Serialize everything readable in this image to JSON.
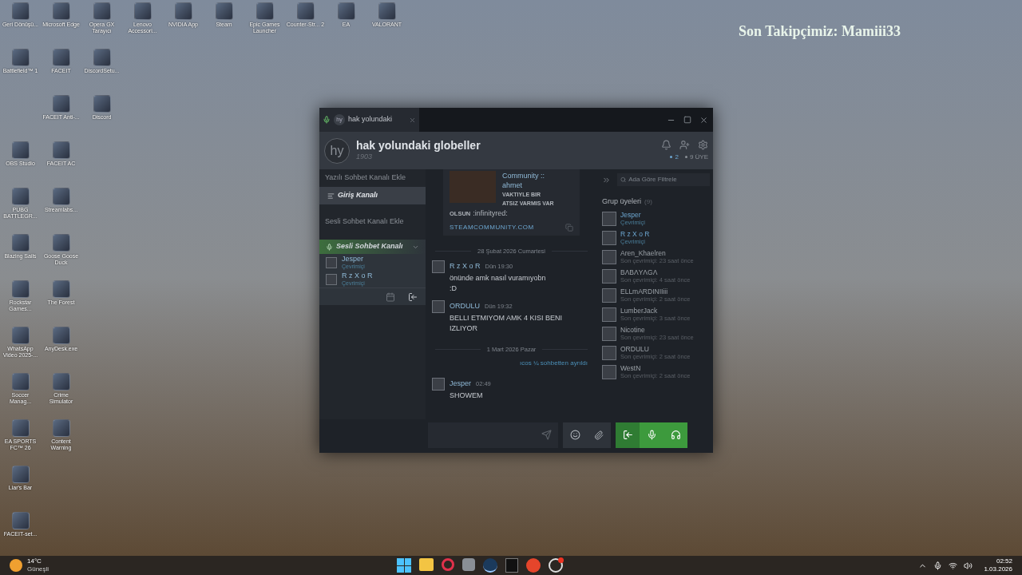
{
  "overlay": {
    "text": "Son Takipçimiz: Mamiii33"
  },
  "desktop_rows": [
    [
      {
        "label": "Geri Dönüşü..."
      },
      {
        "label": "Microsoft Edge"
      },
      {
        "label": "Opera GX Tarayıcı"
      },
      {
        "label": "Lenovo Accessori..."
      },
      {
        "label": "NVIDIA App"
      },
      {
        "label": "Steam"
      },
      {
        "label": "Epic Games Launcher"
      },
      {
        "label": "Counter-Str... 2"
      },
      {
        "label": "EA"
      },
      {
        "label": "VALORANT"
      }
    ],
    [
      {
        "label": "Battlefield™ 1"
      },
      {
        "label": "FACEIT"
      },
      {
        "label": "DiscordSetu..."
      }
    ],
    [
      null,
      {
        "label": "FACEIT Anti-..."
      },
      {
        "label": "Discord"
      }
    ],
    [
      {
        "label": "OBS Studio"
      },
      {
        "label": "FACEIT AC"
      }
    ],
    [
      {
        "label": "PUBG BATTLEGR..."
      },
      {
        "label": "Streamlabs..."
      }
    ],
    [
      {
        "label": "Blazing Sails"
      },
      {
        "label": "Goose Goose Duck"
      }
    ],
    [
      {
        "label": "Rockstar Games..."
      },
      {
        "label": "The Forest"
      }
    ],
    [
      {
        "label": "WhatsApp Video 2025-..."
      },
      {
        "label": "AnyDesk.exe"
      }
    ],
    [
      {
        "label": "Soccer Manag..."
      },
      {
        "label": "Crime Simulator"
      }
    ],
    [
      {
        "label": "EA SPORTS FC™ 26"
      },
      {
        "label": "Content Warning"
      }
    ],
    [
      {
        "label": "Liar's Bar"
      }
    ],
    [
      {
        "label": "FACEIT-set..."
      }
    ]
  ],
  "window": {
    "tab": {
      "avatar": "hy",
      "title": "hak yolundaki"
    },
    "header": {
      "avatar": "hy",
      "title": "hak yolundaki globeller",
      "subtitle": "1903",
      "online_count": "2",
      "member_count": "9 ÜYE"
    },
    "sidebar": {
      "add_text_channel": "Yazılı Sohbet Kanalı Ekle",
      "text_channels": [
        {
          "name": "Giriş Kanalı",
          "selected": true
        }
      ],
      "add_voice_channel": "Sesli Sohbet Kanalı Ekle",
      "voice_channel": {
        "name": "Sesli Sohbet Kanalı",
        "expanded": true,
        "members": [
          {
            "name": "Jesper",
            "status": "Çevrimiçi"
          },
          {
            "name": "R z X o R",
            "status": "Çevrimiçi"
          }
        ]
      }
    },
    "chat": {
      "embed": {
        "lines": [
          "Community ::",
          "ahmet"
        ],
        "caps_lines": [
          "VAKTIYLE BIR",
          "ATSIZ VARMIS VAR"
        ],
        "prefix": "OLSUN",
        "tail": ":infinityred:",
        "link": "STEAMCOMMUNITY.COM"
      },
      "items": [
        {
          "kind": "divider",
          "text": "28 Şubat 2026 Cumartesi"
        },
        {
          "kind": "message",
          "author": "R z X o R",
          "time": "Dün 19:30",
          "lines": [
            "önünde amk nasıl vuramıyobn",
            ":D"
          ]
        },
        {
          "kind": "message",
          "author": "ORDULU",
          "time": "Dün 19:32",
          "lines": [
            "BELLI ETMIYOM AMK 4 KISI BENI IZLIYOR"
          ]
        },
        {
          "kind": "divider",
          "text": "1 Mart 2026 Pazar"
        },
        {
          "kind": "system",
          "text": "ıcos ¼ sohbetten ayrıldı"
        },
        {
          "kind": "message",
          "author": "Jesper",
          "time": "02:49",
          "lines": [
            "SHOWEM"
          ]
        }
      ]
    },
    "members": {
      "search_placeholder": "Ada Göre Filtrele",
      "title": "Grup üyeleri",
      "count": "(9)",
      "list": [
        {
          "name": "Jesper",
          "status": "Çevrimiçi",
          "online": true
        },
        {
          "name": "R z X o R",
          "status": "Çevrimiçi",
          "online": true
        },
        {
          "name": "Aren_Khaelren",
          "status": "Son çevrimiçi: 23 saat önce",
          "online": false
        },
        {
          "name": "BΛBΛYΛGΛ",
          "status": "Son çevrimiçi: 4 saat önce",
          "online": false
        },
        {
          "name": "ELLmARDINIIiii",
          "status": "Son çevrimiçi: 2 saat önce",
          "online": false
        },
        {
          "name": "LumberJack",
          "status": "Son çevrimiçi: 3 saat önce",
          "online": false
        },
        {
          "name": "Nicotine",
          "status": "Son çevrimiçi: 23 saat önce",
          "online": false
        },
        {
          "name": "ORDULU",
          "status": "Son çevrimiçi: 2 saat önce",
          "online": false
        },
        {
          "name": "WestN",
          "status": "Son çevrimiçi: 2 saat önce",
          "online": false
        }
      ]
    }
  },
  "taskbar": {
    "weather": {
      "temp": "14°C",
      "condition": "Güneşli"
    },
    "time": "02:52",
    "date": "1.03.2026"
  }
}
